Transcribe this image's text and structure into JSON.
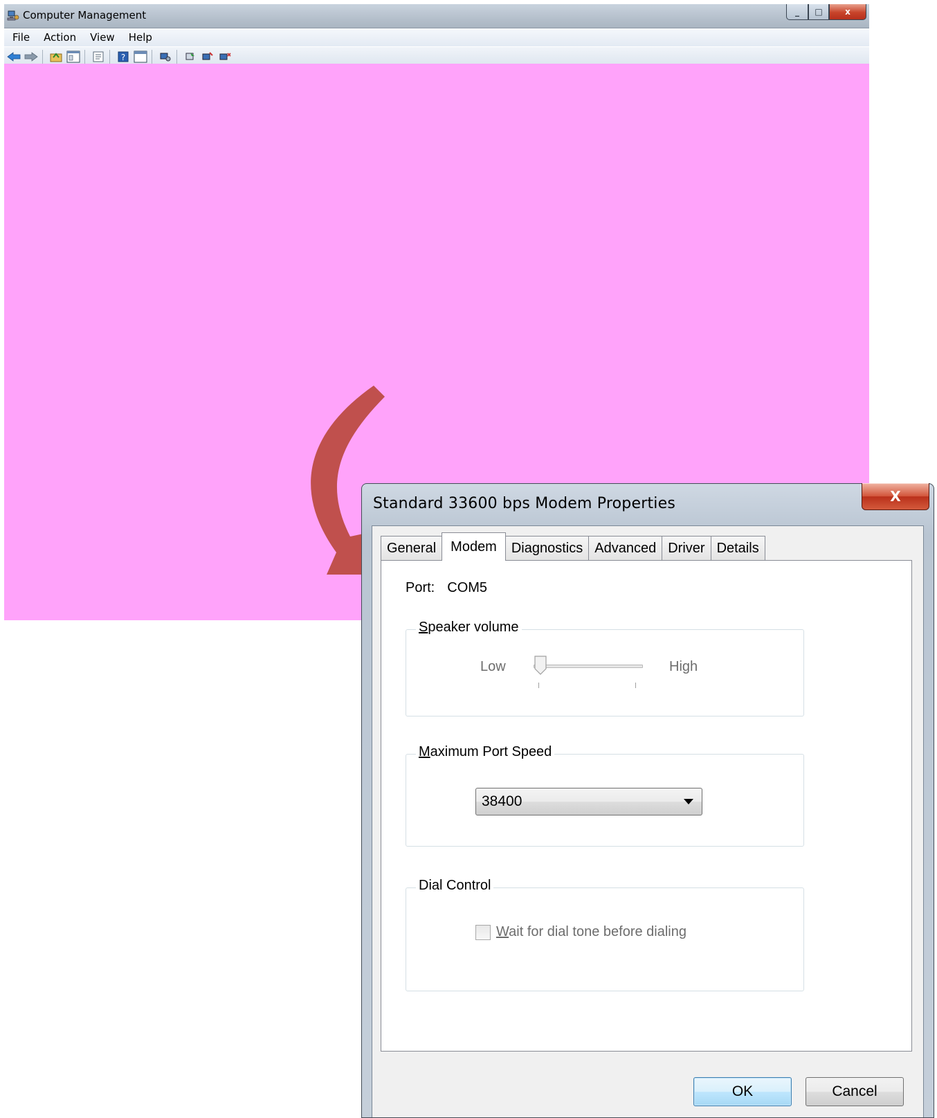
{
  "background_window": {
    "title": "Computer Management",
    "app_icon": "computer-management-icon",
    "menu": [
      "File",
      "Action",
      "View",
      "Help"
    ],
    "toolbar_icons": [
      "back-arrow-icon",
      "forward-arrow-icon",
      "up-folder-icon",
      "show-hide-tree-icon",
      "properties-icon",
      "help-icon",
      "console-window-icon",
      "device-scan-icon",
      "update-driver-icon",
      "disable-device-icon",
      "uninstall-device-icon"
    ],
    "content_fill": "#ffa3fa"
  },
  "annotation_arrow_color": "#c0504d",
  "dialog": {
    "title": "Standard 33600 bps Modem Properties",
    "close_glyph": "X",
    "tabs": [
      "General",
      "Modem",
      "Diagnostics",
      "Advanced",
      "Driver",
      "Details"
    ],
    "active_tab": "Modem",
    "port": {
      "label": "Port:",
      "value": "COM5"
    },
    "speaker_volume": {
      "legend_prefix": "",
      "legend_u": "S",
      "legend_rest": "peaker volume",
      "low": "Low",
      "high": "High",
      "level": 0
    },
    "max_port_speed": {
      "legend_u": "M",
      "legend_rest": "aximum Port Speed",
      "selected": "38400"
    },
    "dial_control": {
      "legend": "Dial Control",
      "checkbox_u": "W",
      "checkbox_rest": "ait for dial tone before dialing",
      "checked": false
    },
    "buttons": {
      "ok": "OK",
      "cancel": "Cancel"
    }
  }
}
